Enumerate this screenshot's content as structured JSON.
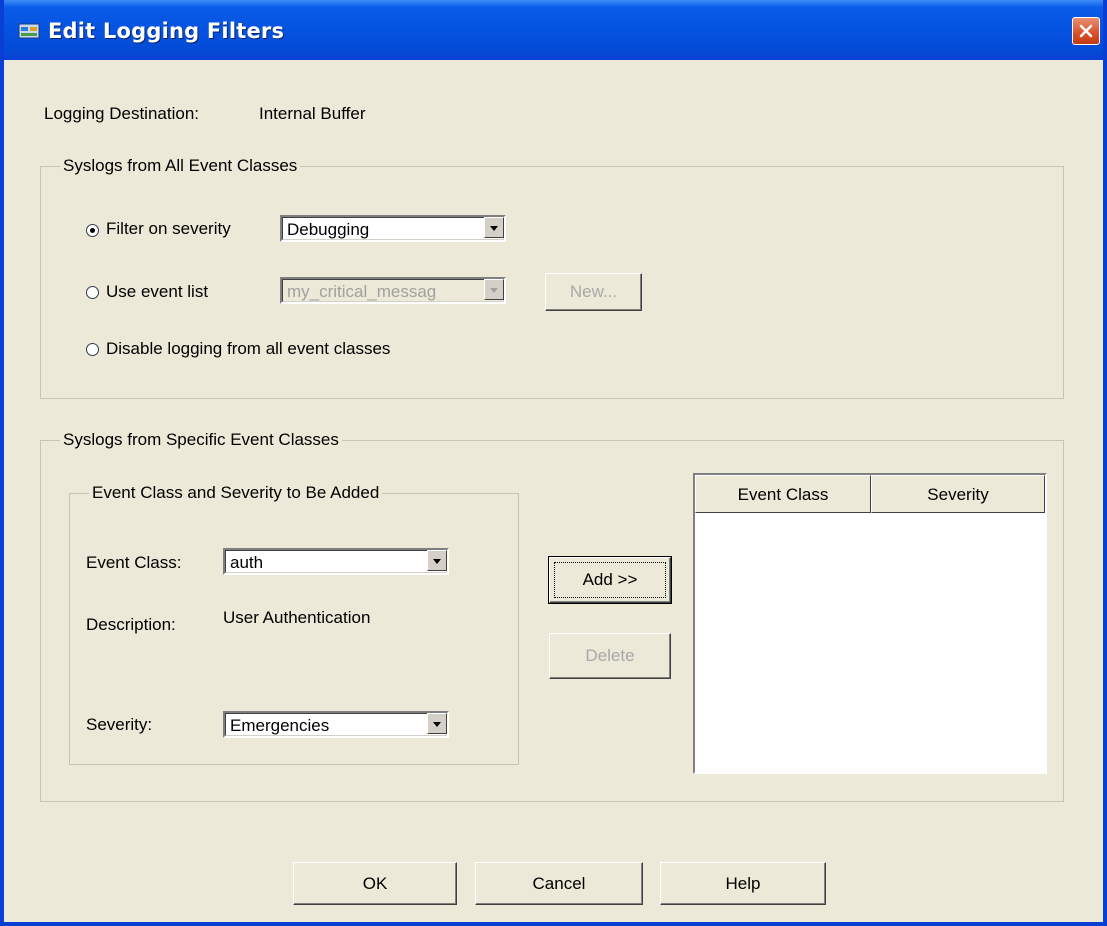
{
  "window": {
    "title": "Edit Logging Filters"
  },
  "destination": {
    "label": "Logging Destination:",
    "value": "Internal Buffer"
  },
  "all_classes": {
    "title": "Syslogs from All Event Classes",
    "filter_severity_label": "Filter on severity",
    "filter_severity_value": "Debugging",
    "event_list_label": "Use event list",
    "event_list_value": "my_critical_messag",
    "new_button": "New...",
    "disable_label": "Disable logging from all event classes",
    "selected": "filter_on_severity"
  },
  "specific_classes": {
    "title": "Syslogs from Specific Event Classes",
    "add_group": {
      "title": "Event Class and Severity to Be Added",
      "event_class_label": "Event Class:",
      "event_class_value": "auth",
      "description_label": "Description:",
      "description_value": "User Authentication",
      "severity_label": "Severity:",
      "severity_value": "Emergencies"
    },
    "add_button": "Add >>",
    "delete_button": "Delete",
    "table": {
      "columns": [
        "Event Class",
        "Severity"
      ],
      "rows": []
    }
  },
  "buttons": {
    "ok": "OK",
    "cancel": "Cancel",
    "help": "Help"
  },
  "colors": {
    "title_bar": "#0553e0",
    "dialog_bg": "#ece9d8",
    "close": "#d8502a"
  },
  "icons": {
    "title": "app-icon",
    "close": "close-icon"
  }
}
